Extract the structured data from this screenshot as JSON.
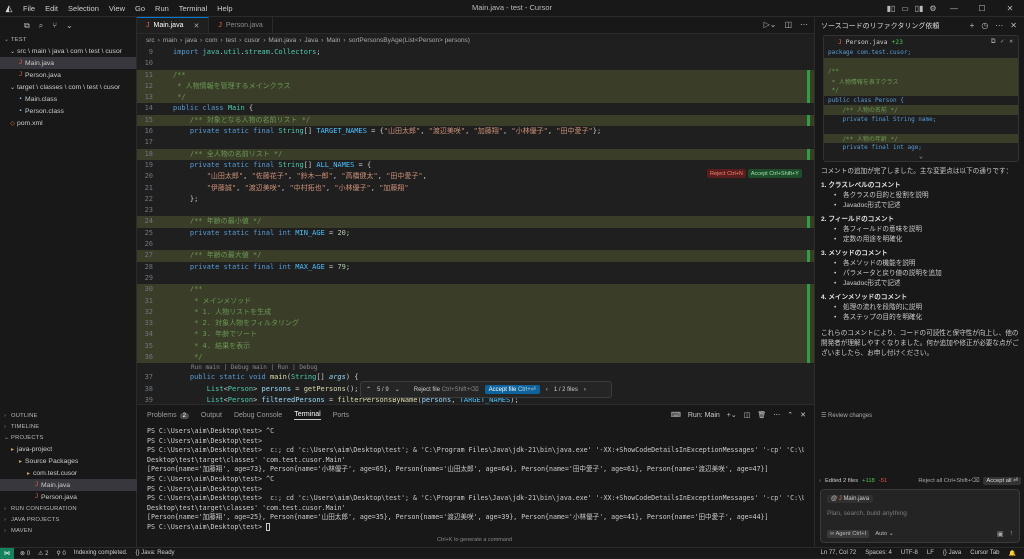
{
  "window": {
    "title": "Main.java - test - Cursor",
    "menus": [
      "File",
      "Edit",
      "Selection",
      "View",
      "Go",
      "Run",
      "Terminal",
      "Help"
    ]
  },
  "explorer": {
    "root": "TEST",
    "items": [
      {
        "label": "src \\ main \\ java \\ com \\ test \\ cusor",
        "icon": "chevron-down",
        "indent": 1,
        "selected": false
      },
      {
        "label": "Main.java",
        "icon": "java",
        "indent": 2,
        "selected": true
      },
      {
        "label": "Person.java",
        "icon": "java",
        "indent": 2,
        "selected": false
      },
      {
        "label": "target \\ classes \\ com \\ test \\ cusor",
        "icon": "chevron-down",
        "indent": 1,
        "selected": false
      },
      {
        "label": "Main.class",
        "icon": "class",
        "indent": 2,
        "selected": false
      },
      {
        "label": "Person.class",
        "icon": "class",
        "indent": 2,
        "selected": false
      },
      {
        "label": "pom.xml",
        "icon": "xml",
        "indent": 1,
        "selected": false
      }
    ],
    "sections": {
      "outline": "OUTLINE",
      "timeline": "TIMELINE",
      "projects": "PROJECTS",
      "run_config": "RUN CONFIGURATION",
      "java_projects": "JAVA PROJECTS",
      "maven": "MAVEN"
    },
    "projects_tree": [
      {
        "label": "java-project",
        "indent": 1,
        "selected": false
      },
      {
        "label": "Source Packages",
        "indent": 2,
        "selected": false
      },
      {
        "label": "com.test.cusor",
        "indent": 3,
        "selected": false
      },
      {
        "label": "Main.java",
        "indent": 4,
        "selected": true
      },
      {
        "label": "Person.java",
        "indent": 4,
        "selected": false
      }
    ]
  },
  "editor": {
    "tabs": [
      {
        "label": "Main.java",
        "active": true
      },
      {
        "label": "Person.java",
        "active": false
      }
    ],
    "breadcrumb": [
      "src",
      "main",
      "java",
      "com",
      "test",
      "cusor",
      "Main.java",
      "Java",
      "Main",
      "sortPersonsByAge(List<Person> persons)"
    ],
    "inline_reject": "Reject  Ctrl+N",
    "inline_accept": "Accept  Ctrl+Shift+Y",
    "codelens": "Run main | Debug main | Run | Debug",
    "accept_bar": {
      "counter": "5 / 9",
      "reject_file": "Reject file",
      "reject_shortcut": "Ctrl+Shift+⌫",
      "accept_file": "Accept file",
      "accept_shortcut": "Ctrl+⏎",
      "files": "1 / 2 files"
    }
  },
  "code_lines": [
    {
      "no": "9",
      "html": "<span class=\"kw\">import</span> <span class=\"ty\">java</span>.<span class=\"ty\">util</span>.<span class=\"ty\">stream</span>.<span class=\"ty\">Collectors</span>;",
      "add": false
    },
    {
      "no": "10",
      "html": "",
      "add": false
    },
    {
      "no": "11",
      "html": "<span class=\"cm\">/**</span>",
      "add": true
    },
    {
      "no": "12",
      "html": "<span class=\"cm\"> * 人物情報を管理するメインクラス</span>",
      "add": true
    },
    {
      "no": "13",
      "html": "<span class=\"cm\"> */</span>",
      "add": true
    },
    {
      "no": "14",
      "html": "<span class=\"kw\">public</span> <span class=\"kw\">class</span> <span class=\"ty\">Main</span> {",
      "add": false
    },
    {
      "no": "15",
      "html": "    <span class=\"cm\">/** 対象となる人物の名前リスト */</span>",
      "add": true
    },
    {
      "no": "16",
      "html": "    <span class=\"kw\">private</span> <span class=\"kw\">static</span> <span class=\"kw\">final</span> <span class=\"ty\">String</span>[] <span class=\"cn\">TARGET_NAMES</span> = {<span class=\"st\">\"山田太郎\"</span>, <span class=\"st\">\"渡辺美咲\"</span>, <span class=\"st\">\"加藤翔\"</span>, <span class=\"st\">\"小林優子\"</span>, <span class=\"st\">\"田中愛子\"</span>};",
      "add": false
    },
    {
      "no": "17",
      "html": "",
      "add": false
    },
    {
      "no": "18",
      "html": "    <span class=\"cm\">/** 全人物の名前リスト */</span>",
      "add": true
    },
    {
      "no": "19",
      "html": "    <span class=\"kw\">private</span> <span class=\"kw\">static</span> <span class=\"kw\">final</span> <span class=\"ty\">String</span>[] <span class=\"cn\">ALL_NAMES</span> = {",
      "add": false
    },
    {
      "no": "20",
      "html": "        <span class=\"st\">\"山田太郎\"</span>, <span class=\"st\">\"佐藤花子\"</span>, <span class=\"st\">\"鈴木一郎\"</span>, <span class=\"st\">\"高橋健太\"</span>, <span class=\"st\">\"田中愛子\"</span>,",
      "add": false
    },
    {
      "no": "21",
      "html": "        <span class=\"st\">\"伊藤誠\"</span>, <span class=\"st\">\"渡辺美咲\"</span>, <span class=\"st\">\"中村拓也\"</span>, <span class=\"st\">\"小林優子\"</span>, <span class=\"st\">\"加藤翔\"</span>",
      "add": false
    },
    {
      "no": "22",
      "html": "    };",
      "add": false
    },
    {
      "no": "23",
      "html": "",
      "add": false
    },
    {
      "no": "24",
      "html": "    <span class=\"cm\">/** 年齢の最小値 */</span>",
      "add": true
    },
    {
      "no": "25",
      "html": "    <span class=\"kw\">private</span> <span class=\"kw\">static</span> <span class=\"kw\">final</span> <span class=\"kw\">int</span> <span class=\"cn\">MIN_AGE</span> = <span class=\"nu\">20</span>;",
      "add": false
    },
    {
      "no": "26",
      "html": "",
      "add": false
    },
    {
      "no": "27",
      "html": "    <span class=\"cm\">/** 年齢の最大値 */</span>",
      "add": true
    },
    {
      "no": "28",
      "html": "    <span class=\"kw\">private</span> <span class=\"kw\">static</span> <span class=\"kw\">final</span> <span class=\"kw\">int</span> <span class=\"cn\">MAX_AGE</span> = <span class=\"nu\">79</span>;",
      "add": false
    },
    {
      "no": "29",
      "html": "",
      "add": false
    },
    {
      "no": "30",
      "html": "    <span class=\"cm\">/**</span>",
      "add": true
    },
    {
      "no": "31",
      "html": "<span class=\"cm\">     * メインメソッド</span>",
      "add": true
    },
    {
      "no": "32",
      "html": "<span class=\"cm\">     * 1. 人物リストを生成</span>",
      "add": true
    },
    {
      "no": "33",
      "html": "<span class=\"cm\">     * 2. 対象人物をフィルタリング</span>",
      "add": true
    },
    {
      "no": "34",
      "html": "<span class=\"cm\">     * 3. 年齢でソート</span>",
      "add": true
    },
    {
      "no": "35",
      "html": "<span class=\"cm\">     * 4. 結果を表示</span>",
      "add": true
    },
    {
      "no": "36",
      "html": "<span class=\"cm\">     */</span>",
      "add": true
    },
    {
      "no": "",
      "html": "CODELENS",
      "add": false
    },
    {
      "no": "37",
      "html": "    <span class=\"kw\">public</span> <span class=\"kw\">static</span> <span class=\"kw\">void</span> <span class=\"fn\">main</span>(<span class=\"ty\">String</span>[] <span class=\"vr\"><i>args</i></span>) {",
      "add": false
    },
    {
      "no": "38",
      "html": "        <span class=\"ty\">List</span>&lt;<span class=\"ty\">Person</span>&gt; <span class=\"vr\">persons</span> = <span class=\"fn\">getPersons</span>();",
      "add": false
    },
    {
      "no": "39",
      "html": "        <span class=\"ty\">List</span>&lt;<span class=\"ty\">Person</span>&gt; <span class=\"vr\">filteredPersons</span> = <span class=\"fn\">filterPersonsByName</span>(<span class=\"vr\">persons</span>, <span class=\"cn\">TARGET_NAMES</span>);",
      "add": false
    },
    {
      "no": "40",
      "html": "        <span class=\"ty\">List</span>&lt;<span class=\"ty\">Person</span>&gt; <span class=\"vr\">sortedPersons</span> = <span class=\"fn\">sortPerso</span>",
      "add": false
    },
    {
      "no": "41",
      "html": "",
      "add": false
    },
    {
      "no": "42",
      "html": "        <span class=\"ty\">System</span>.<span class=\"vr\">out</span>.<span class=\"fn\">println</span>(<span class=\"vr\">sortedPersons</span>);",
      "add": false
    }
  ],
  "panel": {
    "tabs": [
      "Problems",
      "Output",
      "Debug Console",
      "Terminal",
      "Ports"
    ],
    "active_tab": "Terminal",
    "problems_count": "2",
    "run_label": "Run: Main",
    "terminal_lines": [
      "PS C:\\Users\\aim\\Desktop\\test> ^C",
      "PS C:\\Users\\aim\\Desktop\\test>",
      "PS C:\\Users\\aim\\Desktop\\test>  c:; cd 'c:\\Users\\aim\\Desktop\\test'; & 'C:\\Program Files\\Java\\jdk-21\\bin\\java.exe' '-XX:+ShowCodeDetailsInExceptionMessages' '-cp' 'C:\\Users\\aim\\",
      "Desktop\\test\\target\\classes' 'com.test.cusor.Main'",
      "[Person{name='加藤翔', age=73}, Person{name='小林優子', age=65}, Person{name='山田太郎', age=64}, Person{name='田中愛子', age=61}, Person{name='渡辺美咲', age=47}]",
      "PS C:\\Users\\aim\\Desktop\\test> ^C",
      "PS C:\\Users\\aim\\Desktop\\test>",
      "PS C:\\Users\\aim\\Desktop\\test>  c:; cd 'c:\\Users\\aim\\Desktop\\test'; & 'C:\\Program Files\\Java\\jdk-21\\bin\\java.exe' '-XX:+ShowCodeDetailsInExceptionMessages' '-cp' 'C:\\Users\\aim\\",
      "Desktop\\test\\target\\classes' 'com.test.cusor.Main'",
      "[Person{name='加藤翔', age=25}, Person{name='山田太郎', age=35}, Person{name='渡辺美咲', age=39}, Person{name='小林優子', age=41}, Person{name='田中愛子', age=44}]",
      "PS C:\\Users\\aim\\Desktop\\test> "
    ],
    "hint": "Ctrl+K to generate a command"
  },
  "chat": {
    "title": "ソースコードのリファクタリング依頼",
    "diff_file": "Person.java",
    "diff_count": "+23",
    "diff_lines": [
      {
        "text": "package com.test.cusor;",
        "add": false
      },
      {
        "text": "",
        "add": true
      },
      {
        "text": "/**",
        "add": true
      },
      {
        "text": " * 人物情報を表すクラス",
        "add": true
      },
      {
        "text": " */",
        "add": true
      },
      {
        "text": "public class Person {",
        "add": false
      },
      {
        "text": "    /** 人物の名前 */",
        "add": true
      },
      {
        "text": "    private final String name;",
        "add": false
      },
      {
        "text": "",
        "add": false
      },
      {
        "text": "    /** 人物の年齢 */",
        "add": true
      },
      {
        "text": "    private final int age;",
        "add": false
      },
      {
        "text": "",
        "add": false
      }
    ],
    "intro": "コメントの追加が完了しました。主な変更点は以下の通りです：",
    "sections": [
      {
        "heading": "1. クラスレベルのコメント",
        "bullets": [
          "各クラスの目的と役割を説明",
          "Javadoc形式で記述"
        ]
      },
      {
        "heading": "2. フィールドのコメント",
        "bullets": [
          "各フィールドの意味を説明",
          "定数の用途を明確化"
        ]
      },
      {
        "heading": "3. メソッドのコメント",
        "bullets": [
          "各メソッドの機能を説明",
          "パラメータと戻り値の説明を追加",
          "Javadoc形式で記述"
        ]
      },
      {
        "heading": "4. メインメソッドのコメント",
        "bullets": [
          "処理の流れを段階的に説明",
          "各ステップの目的を明確化"
        ]
      }
    ],
    "outro": "これらのコメントにより、コードの可読性と保守性が向上し、他の開発者が理解しやすくなりました。何か追加や修正が必要な点がございましたら、お申し付けください。",
    "review": "Review changes",
    "edited": "Edited 2 files",
    "added": "+118",
    "removed": "-51",
    "reject_all": "Reject all  Ctrl+Shift+⌫",
    "accept_all": "Accept all  ⏎",
    "composer_file": "Main.java",
    "composer_placeholder": "Plan, search, build anything",
    "mode": "Agent  Ctrl+I",
    "model": "Auto"
  },
  "status": {
    "errors": "⊗ 0",
    "warnings": "⚠ 2",
    "ports": "⚲ 0",
    "indexing": "Indexing completed.",
    "java": "{} Java: Ready",
    "position": "Ln 77, Col 72",
    "spaces": "Spaces: 4",
    "encoding": "UTF-8",
    "eol": "LF",
    "lang": "{} Java",
    "cursor_tab": "Cursor Tab"
  }
}
